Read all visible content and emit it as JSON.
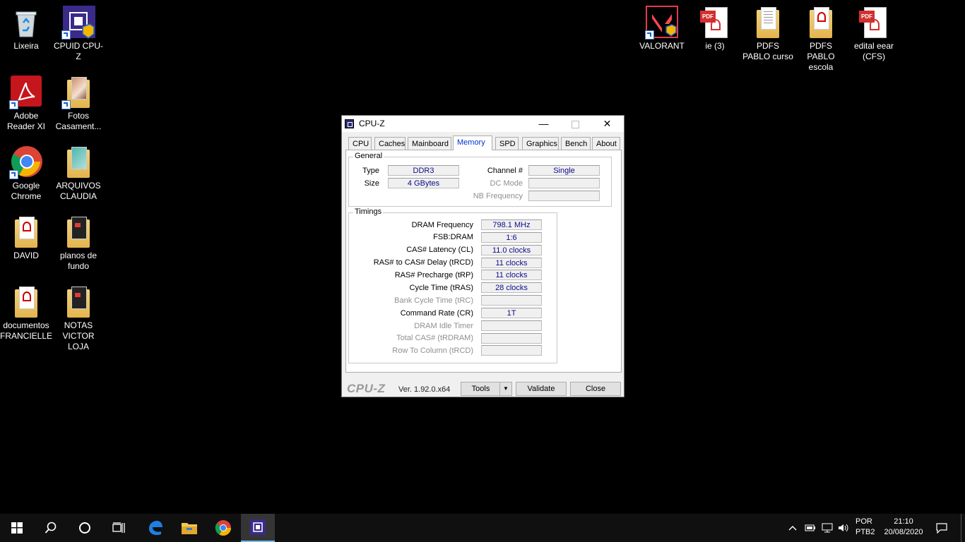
{
  "desktop": {
    "left_icons": [
      {
        "label": "Lixeira"
      },
      {
        "label": "CPUID CPU-Z"
      },
      {
        "label": "Adobe Reader XI"
      },
      {
        "label": "Fotos Casament..."
      },
      {
        "label": "Google Chrome"
      },
      {
        "label": "ARQUIVOS CLAUDIA"
      },
      {
        "label": "DAVID"
      },
      {
        "label": "planos de fundo"
      },
      {
        "label": "documentos FRANCIELLE"
      },
      {
        "label": "NOTAS VICTOR LOJA"
      }
    ],
    "right_icons": [
      {
        "label": "VALORANT"
      },
      {
        "label": "ie (3)",
        "tag": "PDF"
      },
      {
        "label": "PDFS PABLO curso"
      },
      {
        "label": "PDFS PABLO escola"
      },
      {
        "label": "edital eear (CFS)",
        "tag": "PDF"
      }
    ]
  },
  "window": {
    "title": "CPU-Z",
    "tabs": [
      "CPU",
      "Caches",
      "Mainboard",
      "Memory",
      "SPD",
      "Graphics",
      "Bench",
      "About"
    ],
    "active_tab": "Memory",
    "general": {
      "label": "General",
      "type_label": "Type",
      "type_value": "DDR3",
      "size_label": "Size",
      "size_value": "4 GBytes",
      "channel_label": "Channel #",
      "channel_value": "Single",
      "dcmode_label": "DC Mode",
      "dcmode_value": "",
      "nbfreq_label": "NB Frequency",
      "nbfreq_value": ""
    },
    "timings": {
      "label": "Timings",
      "rows": [
        {
          "label": "DRAM Frequency",
          "value": "798.1 MHz"
        },
        {
          "label": "FSB:DRAM",
          "value": "1:6"
        },
        {
          "label": "CAS# Latency (CL)",
          "value": "11.0 clocks"
        },
        {
          "label": "RAS# to CAS# Delay (tRCD)",
          "value": "11 clocks"
        },
        {
          "label": "RAS# Precharge (tRP)",
          "value": "11 clocks"
        },
        {
          "label": "Cycle Time (tRAS)",
          "value": "28 clocks"
        },
        {
          "label": "Bank Cycle Time (tRC)",
          "value": ""
        },
        {
          "label": "Command Rate (CR)",
          "value": "1T"
        },
        {
          "label": "DRAM Idle Timer",
          "value": ""
        },
        {
          "label": "Total CAS# (tRDRAM)",
          "value": ""
        },
        {
          "label": "Row To Column (tRCD)",
          "value": ""
        }
      ]
    },
    "footer": {
      "logo": "CPU-Z",
      "version": "Ver. 1.92.0.x64",
      "tools_label": "Tools",
      "validate_label": "Validate",
      "close_label": "Close"
    }
  },
  "taskbar": {
    "lang_top": "POR",
    "lang_bottom": "PTB2",
    "time": "21:10",
    "date": "20/08/2020"
  }
}
